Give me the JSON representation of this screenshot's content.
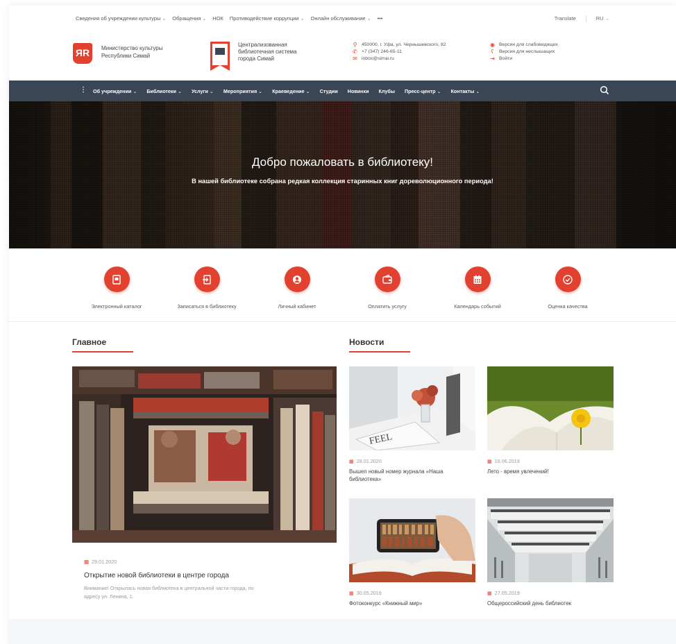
{
  "topbar": {
    "links": [
      "Сведения об учреждении культуры",
      "Обращения",
      "НОК",
      "Противодействие коррупции",
      "Онлайн обслуживание",
      "•••"
    ],
    "translate": "Translate",
    "lang": "RU"
  },
  "header": {
    "logo1_glyph": "ЯR",
    "org1_line1": "Министерство культуры",
    "org1_line2": "Республики Симай",
    "org2_line1": "Централизованная",
    "org2_line2": "библиотечная система",
    "org2_line3": "города Симай",
    "address": "450000, г. Уфа, ул. Чернышевского, 82",
    "phone": "+7 (347) 246-65-11",
    "email": "inbox@simai.ru",
    "low_vision": "Версия для слабовидящих",
    "hearing": "Версия для неслышащих",
    "login": "Войти"
  },
  "nav": {
    "items": [
      "Об учреждении",
      "Библиотеки",
      "Услуги",
      "Мероприятия",
      "Краеведение",
      "Студии",
      "Новинки",
      "Клубы",
      "Пресс-центр",
      "Контакты"
    ]
  },
  "hero": {
    "title": "Добро пожаловать в библиотеку!",
    "subtitle": "В нашей библиотеке собрана редкая коллекция старинных книг дореволюционного периода!"
  },
  "services": [
    "Электронный каталог",
    "Записаться в библиотеку",
    "Личный кабинет",
    "Оплатить услугу",
    "Календарь событий",
    "Оценка качества"
  ],
  "main_section": {
    "title": "Главное",
    "date": "29.01.2020",
    "headline": "Открытие новой библиотеки в центре города",
    "desc_line1": "Внимание! Открылась новая библиотека в центральной части города, по",
    "desc_line2": "адресу ул. Ленина, 1."
  },
  "news_section": {
    "title": "Новости",
    "cards": [
      {
        "date": "28.01.2020",
        "title_line1": "Вышел новый номер журнала «Наша",
        "title_line2": "библиотека»"
      },
      {
        "date": "16.06.2019",
        "title_line1": "Лето - время увлечений!",
        "title_line2": ""
      },
      {
        "date": "30.05.2019",
        "title_line1": "Фотоконкурс «Книжный мир»",
        "title_line2": ""
      },
      {
        "date": "27.05.2019",
        "title_line1": "Общероссийский день библиотек",
        "title_line2": ""
      }
    ]
  },
  "colors": {
    "accent": "#e2412f",
    "nav_bg": "#3a4655"
  }
}
